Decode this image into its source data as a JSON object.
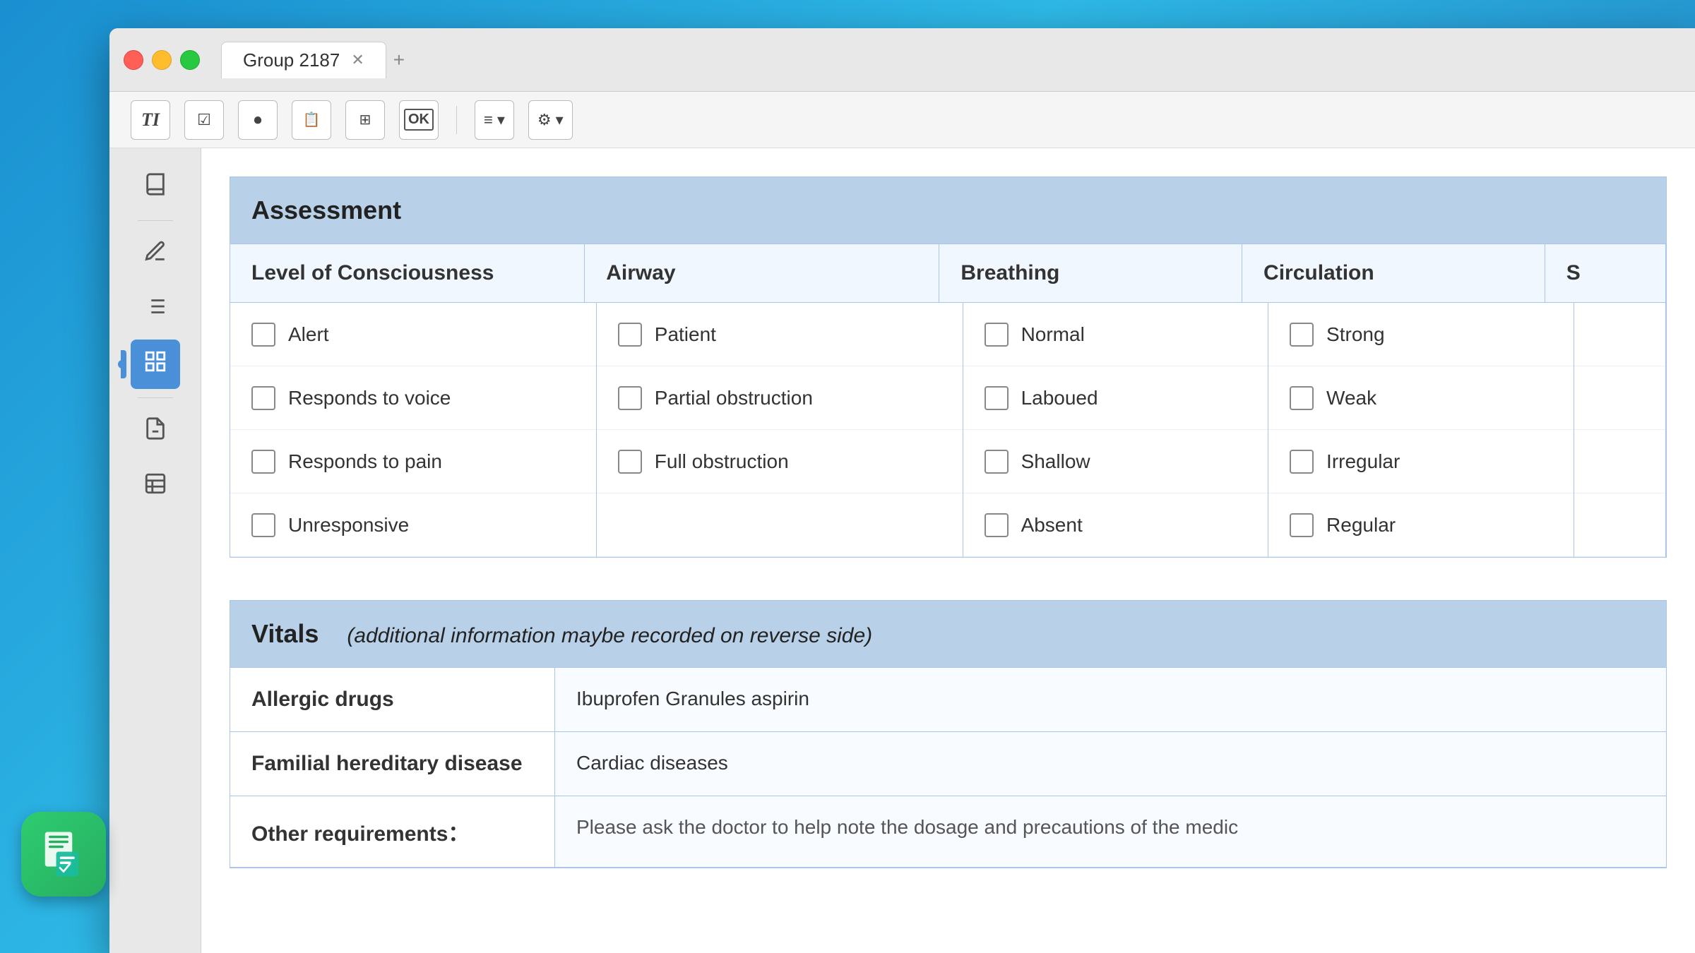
{
  "window": {
    "title": "Group 2187"
  },
  "toolbar": {
    "buttons": [
      {
        "name": "text-tool",
        "icon": "T̲I",
        "label": "Text"
      },
      {
        "name": "checkbox-tool",
        "icon": "☑",
        "label": "Checkbox"
      },
      {
        "name": "record-tool",
        "icon": "⏺",
        "label": "Record"
      },
      {
        "name": "form-tool",
        "icon": "📋",
        "label": "Form"
      },
      {
        "name": "layout-tool",
        "icon": "⊞",
        "label": "Layout"
      },
      {
        "name": "ok-tool",
        "icon": "OK",
        "label": "OK"
      },
      {
        "name": "list-tool",
        "icon": "≡",
        "label": "List"
      },
      {
        "name": "settings-tool",
        "icon": "⚙",
        "label": "Settings"
      }
    ]
  },
  "sidebar": {
    "items": [
      {
        "name": "book-icon",
        "icon": "📖"
      },
      {
        "name": "highlight-icon",
        "icon": "🖊"
      },
      {
        "name": "list-icon",
        "icon": "☰"
      },
      {
        "name": "grid-icon",
        "icon": "⊞"
      },
      {
        "name": "doc-icon",
        "icon": "📄"
      },
      {
        "name": "table-icon",
        "icon": "⊟"
      }
    ]
  },
  "assessment": {
    "title": "Assessment",
    "columns": {
      "level_of_consciousness": {
        "header": "Level of Consciousness",
        "items": [
          "Alert",
          "Responds to voice",
          "Responds to pain",
          "Unresponsive"
        ]
      },
      "airway": {
        "header": "Airway",
        "items": [
          "Patient",
          "Partial obstruction",
          "Full obstruction"
        ]
      },
      "breathing": {
        "header": "Breathing",
        "items": [
          "Normal",
          "Laboued",
          "Shallow",
          "Absent"
        ]
      },
      "circulation": {
        "header": "Circulation",
        "items": [
          "Strong",
          "Weak",
          "Irregular",
          "Regular"
        ]
      },
      "s": {
        "header": "S"
      }
    }
  },
  "vitals": {
    "title": "Vitals",
    "subtitle": "(additional information maybe recorded on reverse side)",
    "rows": [
      {
        "label": "Allergic drugs",
        "value": "Ibuprofen Granules  aspirin"
      },
      {
        "label": "Familial hereditary disease",
        "value": "Cardiac diseases"
      },
      {
        "label": "Other requirements：",
        "value": "Please ask the doctor to help note the dosage and precautions of the medic"
      }
    ]
  },
  "app_icon": {
    "symbol": "📋"
  }
}
